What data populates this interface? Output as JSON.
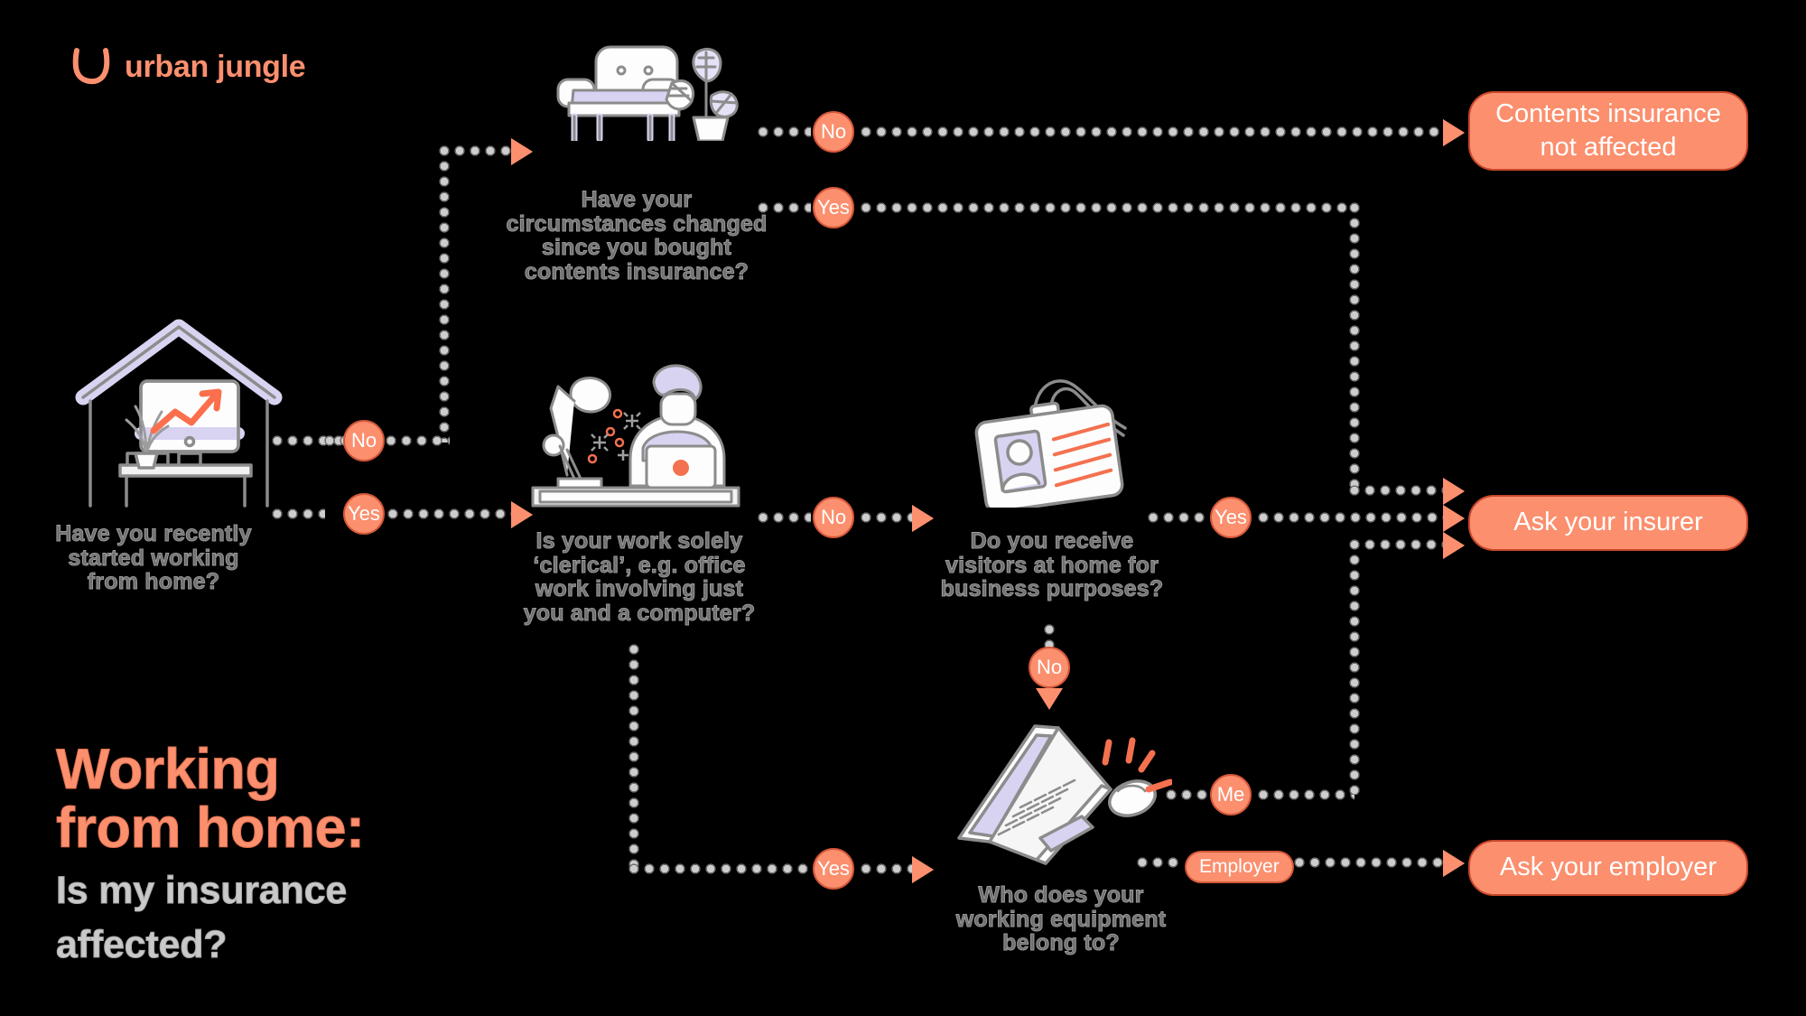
{
  "brand": {
    "name": "urban jungle",
    "accent": "#fb8f6e",
    "mark": "arc-u-icon"
  },
  "headline": {
    "title": "Working\nfrom home:",
    "title_line1": "Working",
    "title_line2": "from home:",
    "subtitle_line1": "Is my insurance",
    "subtitle_line2": "affected?"
  },
  "colors": {
    "background": "#000000",
    "accent_coral": "#fb8f6e",
    "accent_coral_border": "#c9472a",
    "caption_grey": "#6f6f6f",
    "illustration_lavender": "#d9d3f2",
    "illustration_outline": "#8c8c8c",
    "dot_grey": "#cdcdcd"
  },
  "questions": [
    {
      "id": "started-wfh",
      "illustration": "house-with-desk-monitor-icon",
      "text_lines": [
        "Have you recently",
        "started working",
        "from home?"
      ],
      "answers": [
        "No",
        "Yes"
      ]
    },
    {
      "id": "circumstances-changed",
      "illustration": "armchair-and-plant-icon",
      "text_lines": [
        "Have your",
        "circumstances changed",
        "since you bought",
        "contents insurance?"
      ],
      "answers": [
        "No",
        "Yes"
      ]
    },
    {
      "id": "clerical-work",
      "illustration": "person-at-desk-with-laptop-icon",
      "text_lines": [
        "Is your work solely",
        "‘clerical’, e.g. office",
        "work involving just",
        "you and a computer?"
      ],
      "answers": [
        "No",
        "Yes"
      ]
    },
    {
      "id": "business-visitors",
      "illustration": "id-badge-lanyard-icon",
      "text_lines": [
        "Do you receive",
        "visitors at home for",
        "business purposes?"
      ],
      "answers": [
        "Yes",
        "No"
      ]
    },
    {
      "id": "equipment-owner",
      "illustration": "laptop-and-mouse-icon",
      "text_lines": [
        "Who does your",
        "working equipment",
        "belong to?"
      ],
      "answers": [
        "Me",
        "Employer"
      ]
    }
  ],
  "edge_labels": {
    "no": "No",
    "yes": "Yes",
    "me": "Me",
    "employer": "Employer"
  },
  "results": [
    {
      "id": "not-affected",
      "line1": "Contents insurance",
      "line2": "not affected"
    },
    {
      "id": "ask-insurer",
      "line1": "Ask your insurer",
      "line2": ""
    },
    {
      "id": "ask-employer",
      "line1": "Ask your employer",
      "line2": ""
    }
  ]
}
